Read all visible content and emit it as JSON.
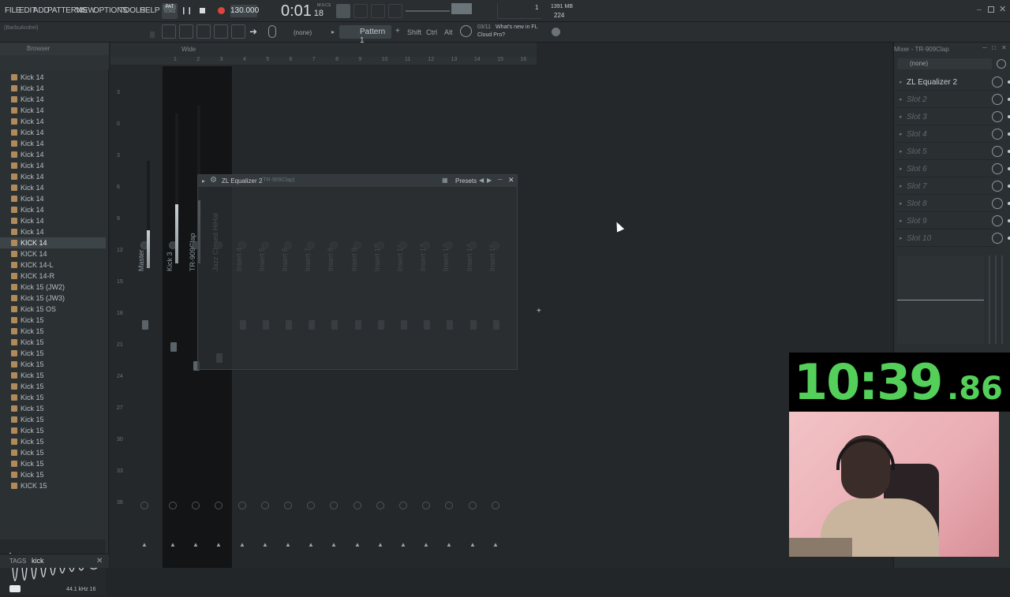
{
  "menu": [
    "FILE",
    "EDIT",
    "ADD",
    "PATTERNS",
    "VIEW",
    "OPTIONS",
    "TOOLS",
    "HELP"
  ],
  "transport": {
    "mode_label": "PAT",
    "mode_sub": "SONG",
    "tempo": "130.000",
    "time": "0:01",
    "time_sub": "18",
    "time_unit": "M:S:CS"
  },
  "cpu": {
    "memory": "1391 MB",
    "polyphony": "224",
    "cpu_val": "1"
  },
  "user_label": "(BarbuAndrei)",
  "toolbar": {
    "pattern_select": "(none)",
    "pattern_name": "Pattern 1",
    "shift": "Shift",
    "ctrl": "Ctrl",
    "alt": "Alt",
    "news_index": "03/11",
    "news_text_1": "What's new in FL",
    "news_text_2": "Cloud Pro?"
  },
  "browser": {
    "title": "Browser",
    "items": [
      "Kick 14",
      "Kick 14",
      "Kick 14",
      "Kick 14",
      "Kick 14",
      "Kick 14",
      "Kick 14",
      "Kick 14",
      "Kick 14",
      "Kick 14",
      "Kick 14",
      "Kick 14",
      "Kick 14",
      "Kick 14",
      "Kick 14",
      "KICK 14",
      "KICK 14",
      "KICK 14-L",
      "KICK 14-R",
      "Kick 15 (JW2)",
      "Kick 15 (JW3)",
      "Kick 15 OS",
      "Kick 15",
      "Kick 15",
      "Kick 15",
      "Kick 15",
      "Kick 15",
      "Kick 15",
      "Kick 15",
      "Kick 15",
      "Kick 15",
      "Kick 15",
      "Kick 15",
      "Kick 15",
      "Kick 15",
      "Kick 15",
      "Kick 15",
      "KICK 15"
    ],
    "selected_index": 15,
    "sample_info": "44.1 kHz 16",
    "tags_label": "TAGS",
    "search_value": "kick"
  },
  "mixer": {
    "view_label": "Wide",
    "insert_numbers": [
      "1",
      "2",
      "3",
      "4",
      "5",
      "6",
      "7",
      "8",
      "9",
      "10",
      "11",
      "12",
      "13",
      "14",
      "15",
      "16"
    ],
    "db_scale": [
      "3",
      "0",
      "3",
      "6",
      "9",
      "12",
      "15",
      "18",
      "21",
      "24",
      "27",
      "30",
      "33",
      "36"
    ],
    "strips": [
      "Master",
      "Kick 3",
      "TR-909Clap",
      "Jazz Closed HiHat",
      "Insert 4",
      "Insert 5",
      "Insert 6",
      "Insert 7",
      "Insert 8",
      "Insert 9",
      "Insert 10",
      "Insert 11",
      "Insert 12",
      "Insert 13",
      "Insert 14",
      "Insert 15"
    ]
  },
  "plugin_window": {
    "title": "ZL Equalizer 2",
    "subtitle": "(TR-909Clap)",
    "presets_label": "Presets"
  },
  "mixer_rack": {
    "title": "Mixer - TR-909Clap",
    "preset": "(none)",
    "slots": [
      {
        "name": "ZL Equalizer 2",
        "active": true
      },
      {
        "name": "Slot 2",
        "active": false
      },
      {
        "name": "Slot 3",
        "active": false
      },
      {
        "name": "Slot 4",
        "active": false
      },
      {
        "name": "Slot 5",
        "active": false
      },
      {
        "name": "Slot 6",
        "active": false
      },
      {
        "name": "Slot 7",
        "active": false
      },
      {
        "name": "Slot 8",
        "active": false
      },
      {
        "name": "Slot 9",
        "active": false
      },
      {
        "name": "Slot 10",
        "active": false
      }
    ]
  },
  "speedrun_timer": {
    "main": "10:39",
    "fraction": ".86"
  },
  "colors": {
    "timer_green": "#54d05a",
    "accent_orange": "#d4a04a",
    "record_red": "#e0443a"
  }
}
